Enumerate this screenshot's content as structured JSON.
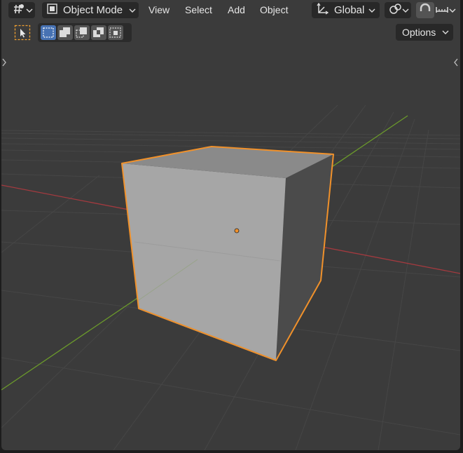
{
  "header": {
    "mode_label": "Object Mode",
    "menus": [
      "View",
      "Select",
      "Add",
      "Object"
    ],
    "orientation_label": "Global"
  },
  "toolbar": {
    "options_label": "Options"
  },
  "colors": {
    "background": "#3b3b3b",
    "selection_outline": "#f0912b",
    "x_axis": "#a33a3f",
    "y_axis": "#6b9a2b",
    "active_button": "#4772b3"
  },
  "icons": {
    "editor_type": "editor-type-icon",
    "object_mode": "object-mode-icon",
    "orientation": "transform-orientation-icon",
    "pivot": "pivot-point-icon",
    "snap": "snap-icon",
    "proportional": "proportional-editing-icon",
    "select_tool": "select-box-tool-icon"
  }
}
